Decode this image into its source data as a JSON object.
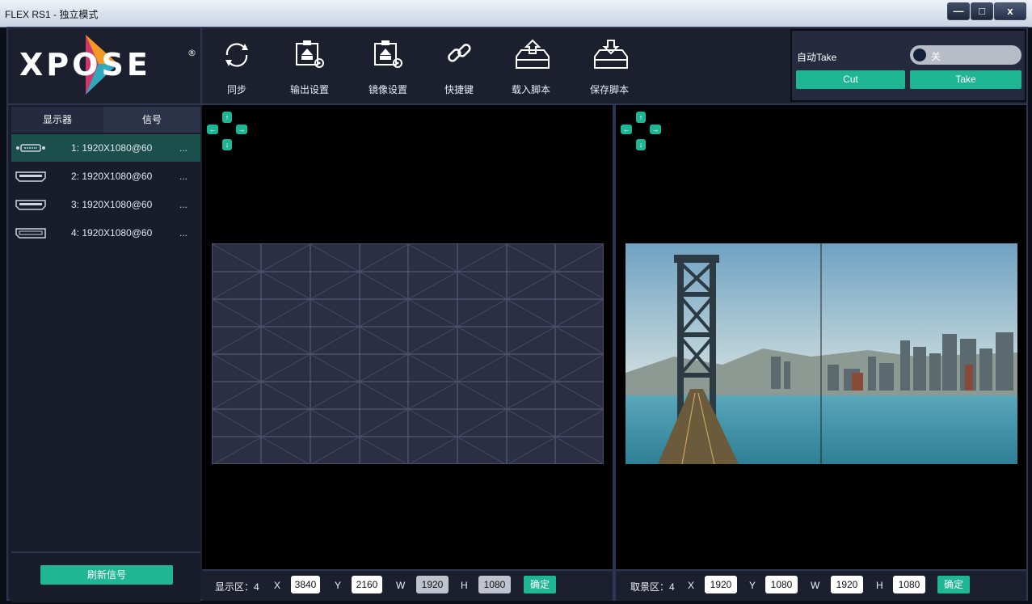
{
  "window": {
    "title": "FLEX RS1 - 独立模式",
    "minimize": "—",
    "maximize": "□",
    "close": "x"
  },
  "logo": {
    "text": "XPOSE",
    "registered": "®"
  },
  "toolbar": [
    {
      "label": "同步",
      "icon": "sync-icon"
    },
    {
      "label": "输出设置",
      "icon": "output-settings-icon"
    },
    {
      "label": "镜像设置",
      "icon": "mirror-settings-icon"
    },
    {
      "label": "快捷键",
      "icon": "shortcut-link-icon"
    },
    {
      "label": "载入脚本",
      "icon": "load-script-icon"
    },
    {
      "label": "保存脚本",
      "icon": "save-script-icon"
    }
  ],
  "take": {
    "auto_label": "自动Take",
    "toggle_state": "关",
    "cut_label": "Cut",
    "take_label": "Take"
  },
  "sidebar": {
    "tabs": {
      "display": "显示器",
      "signal": "信号"
    },
    "signals": [
      {
        "label": "1: 1920X1080@60",
        "more": "...",
        "icon": "dvi-connector-icon",
        "active": true
      },
      {
        "label": "2: 1920X1080@60",
        "more": "...",
        "icon": "hdmi-connector-icon",
        "active": false
      },
      {
        "label": "3: 1920X1080@60",
        "more": "...",
        "icon": "hdmi-connector-icon",
        "active": false
      },
      {
        "label": "4: 1920X1080@60",
        "more": "...",
        "icon": "displayport-connector-icon",
        "active": false
      }
    ],
    "refresh_label": "刷新信号"
  },
  "dpad": {
    "up": "↑",
    "down": "↓",
    "left": "←",
    "right": "→"
  },
  "display_coords": {
    "label": "显示区：4",
    "x_label": "X",
    "x": "3840",
    "y_label": "Y",
    "y": "2160",
    "w_label": "W",
    "w": "1920",
    "h_label": "H",
    "h": "1080",
    "ok_label": "确定"
  },
  "capture_coords": {
    "label": "取景区：4",
    "x_label": "X",
    "x": "1920",
    "y_label": "Y",
    "y": "1080",
    "w_label": "W",
    "w": "1920",
    "h_label": "H",
    "h": "1080",
    "ok_label": "确定"
  },
  "colors": {
    "accent": "#1fb694",
    "background": "#1b1f2e",
    "canvas": "#000000"
  }
}
